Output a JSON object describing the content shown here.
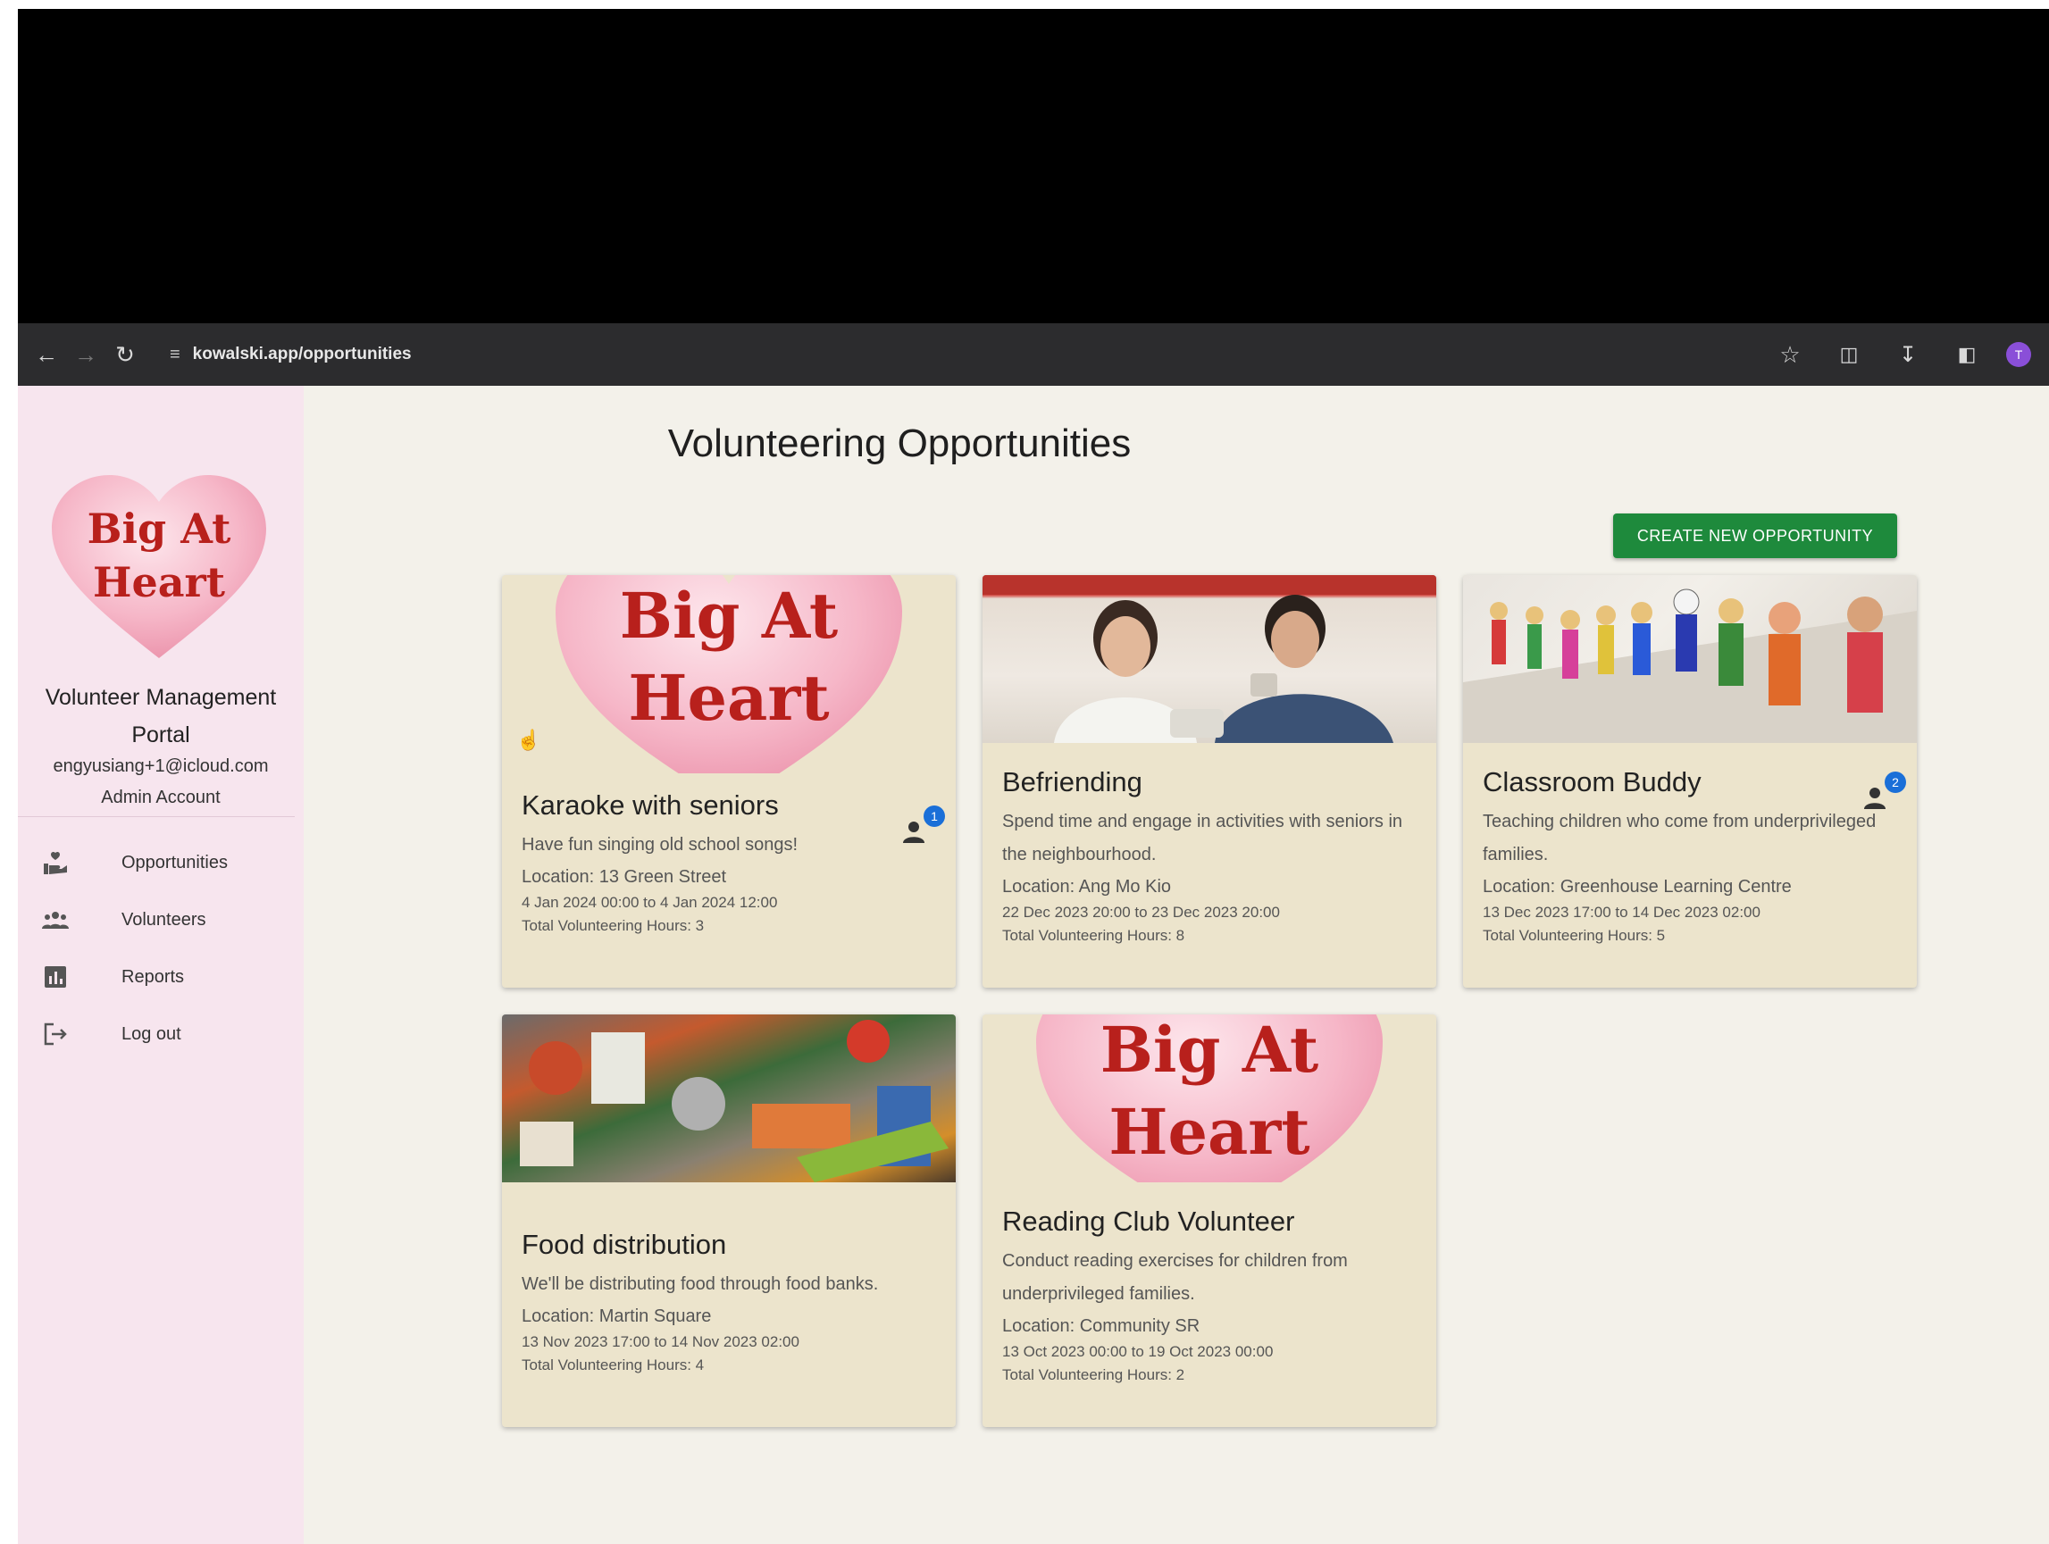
{
  "browser": {
    "url": "kowalski.app/opportunities",
    "profile_initial": "T"
  },
  "sidebar": {
    "logo_line1": "Big At",
    "logo_line2": "Heart",
    "portal_title": "Volunteer Management Portal",
    "email": "engyusiang+1@icloud.com",
    "role": "Admin Account",
    "items": [
      {
        "label": "Opportunities",
        "icon": "volunteer-hand-icon"
      },
      {
        "label": "Volunteers",
        "icon": "people-icon"
      },
      {
        "label": "Reports",
        "icon": "report-chart-icon"
      },
      {
        "label": "Log out",
        "icon": "logout-icon"
      }
    ]
  },
  "main": {
    "title": "Volunteering Opportunities",
    "create_button": "CREATE NEW OPPORTUNITY"
  },
  "cards": [
    {
      "title": "Karaoke with seniors",
      "description": "Have fun singing old school songs!",
      "location": "Location: 13 Green Street",
      "dates": "4 Jan 2024 00:00 to 4 Jan 2024 12:00",
      "hours": "Total Volunteering Hours: 3",
      "image": "logo",
      "badge": "1"
    },
    {
      "title": "Befriending",
      "description": "Spend time and engage in activities with seniors in the neighbourhood.",
      "location": "Location: Ang Mo Kio",
      "dates": "22 Dec 2023 20:00 to 23 Dec 2023 20:00",
      "hours": "Total Volunteering Hours: 8",
      "image": "photo"
    },
    {
      "title": "Classroom Buddy",
      "description": "Teaching children who come from underprivileged families.",
      "location": "Location: Greenhouse Learning Centre",
      "dates": "13 Dec 2023 17:00 to 14 Dec 2023 02:00",
      "hours": "Total Volunteering Hours: 5",
      "image": "photo",
      "badge": "2"
    },
    {
      "title": "Food distribution",
      "description": "We'll be distributing food through food banks.",
      "location": "Location: Martin Square",
      "dates": "13 Nov 2023 17:00 to 14 Nov 2023 02:00",
      "hours": "Total Volunteering Hours: 4",
      "image": "photo"
    },
    {
      "title": "Reading Club Volunteer",
      "description": "Conduct reading exercises for children from underprivileged families.",
      "location": "Location: Community SR",
      "dates": "13 Oct 2023 00:00 to 19 Oct 2023 00:00",
      "hours": "Total Volunteering Hours: 2",
      "image": "logo"
    }
  ],
  "colors": {
    "accent_green": "#1e8a3c",
    "sidebar_pink": "#f7e5ee",
    "card_beige": "#ece4cc",
    "logo_red": "#b8201c",
    "badge_blue": "#1a6fd8"
  }
}
